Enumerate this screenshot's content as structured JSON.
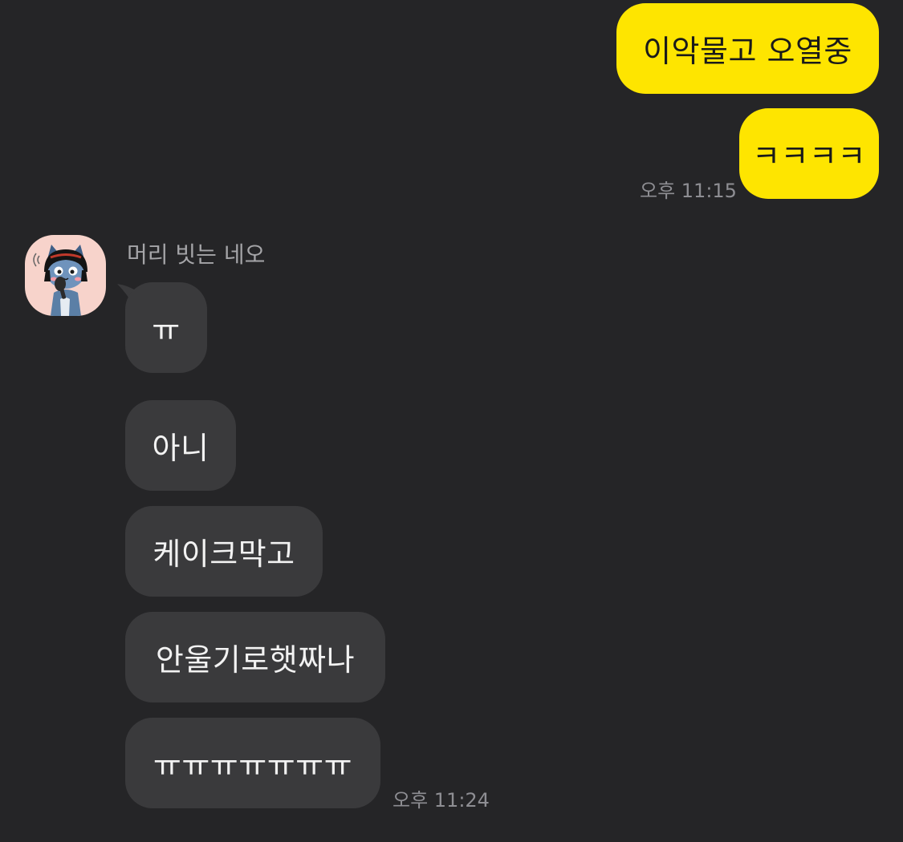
{
  "chat": {
    "outgoing": [
      {
        "text": "이악물고 오열중"
      },
      {
        "text": "ㅋㅋㅋㅋ"
      }
    ],
    "outgoing_time": "오후 11:15",
    "incoming_sender": "머리 빗는 네오",
    "incoming": [
      {
        "text": "ㅠ"
      },
      {
        "text": "아니"
      },
      {
        "text": "케이크막고"
      },
      {
        "text": "안울기로햇짜나"
      },
      {
        "text": "ㅠㅠㅠㅠㅠㅠㅠ"
      }
    ],
    "incoming_time": "오후 11:24"
  },
  "colors": {
    "background": "#252527",
    "outgoing_bubble": "#fee500",
    "incoming_bubble": "#3a3a3c",
    "avatar_background": "#f7d3cb"
  },
  "icons": {
    "avatar": "neo-combing-hair-avatar-icon"
  }
}
